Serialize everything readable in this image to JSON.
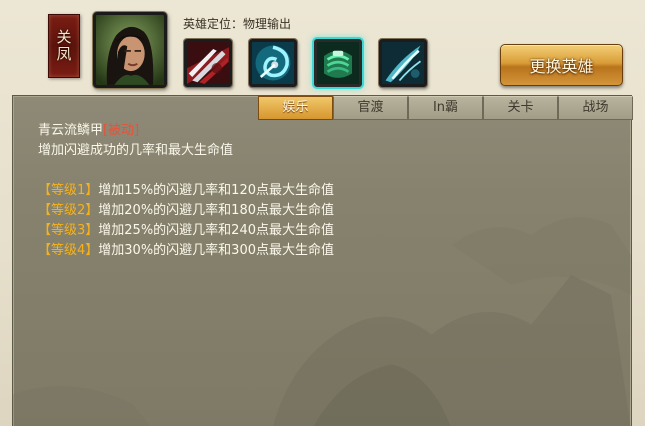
{
  "hero": {
    "name": "关凤",
    "role_label": "英雄定位：物理输出"
  },
  "skills": [
    {
      "icon": "red-claw-slash-icon",
      "selected": false
    },
    {
      "icon": "cyan-spiral-icon",
      "selected": false
    },
    {
      "icon": "green-scale-armor-icon",
      "selected": true
    },
    {
      "icon": "blue-wing-slash-icon",
      "selected": false
    }
  ],
  "change_hero_label": "更换英雄",
  "tabs": [
    {
      "label": "娱乐",
      "active": true
    },
    {
      "label": "官渡",
      "active": false
    },
    {
      "label": "In霸",
      "active": false
    },
    {
      "label": "关卡",
      "active": false
    },
    {
      "label": "战场",
      "active": false
    }
  ],
  "skill_detail": {
    "name": "青云流鳞甲",
    "type_tag": "[被动]",
    "description": "增加闪避成功的几率和最大生命值",
    "levels": [
      {
        "tag": "【等级1】",
        "text": "增加15%的闪避几率和120点最大生命值"
      },
      {
        "tag": "【等级2】",
        "text": "增加20%的闪避几率和180点最大生命值"
      },
      {
        "tag": "【等级3】",
        "text": "增加25%的闪避几率和240点最大生命值"
      },
      {
        "tag": "【等级4】",
        "text": "增加30%的闪避几率和300点最大生命值"
      }
    ]
  },
  "colors": {
    "accent_gold": "#f6b21b",
    "passive_red": "#e6533a",
    "selected_glow": "#3fd7d2"
  }
}
